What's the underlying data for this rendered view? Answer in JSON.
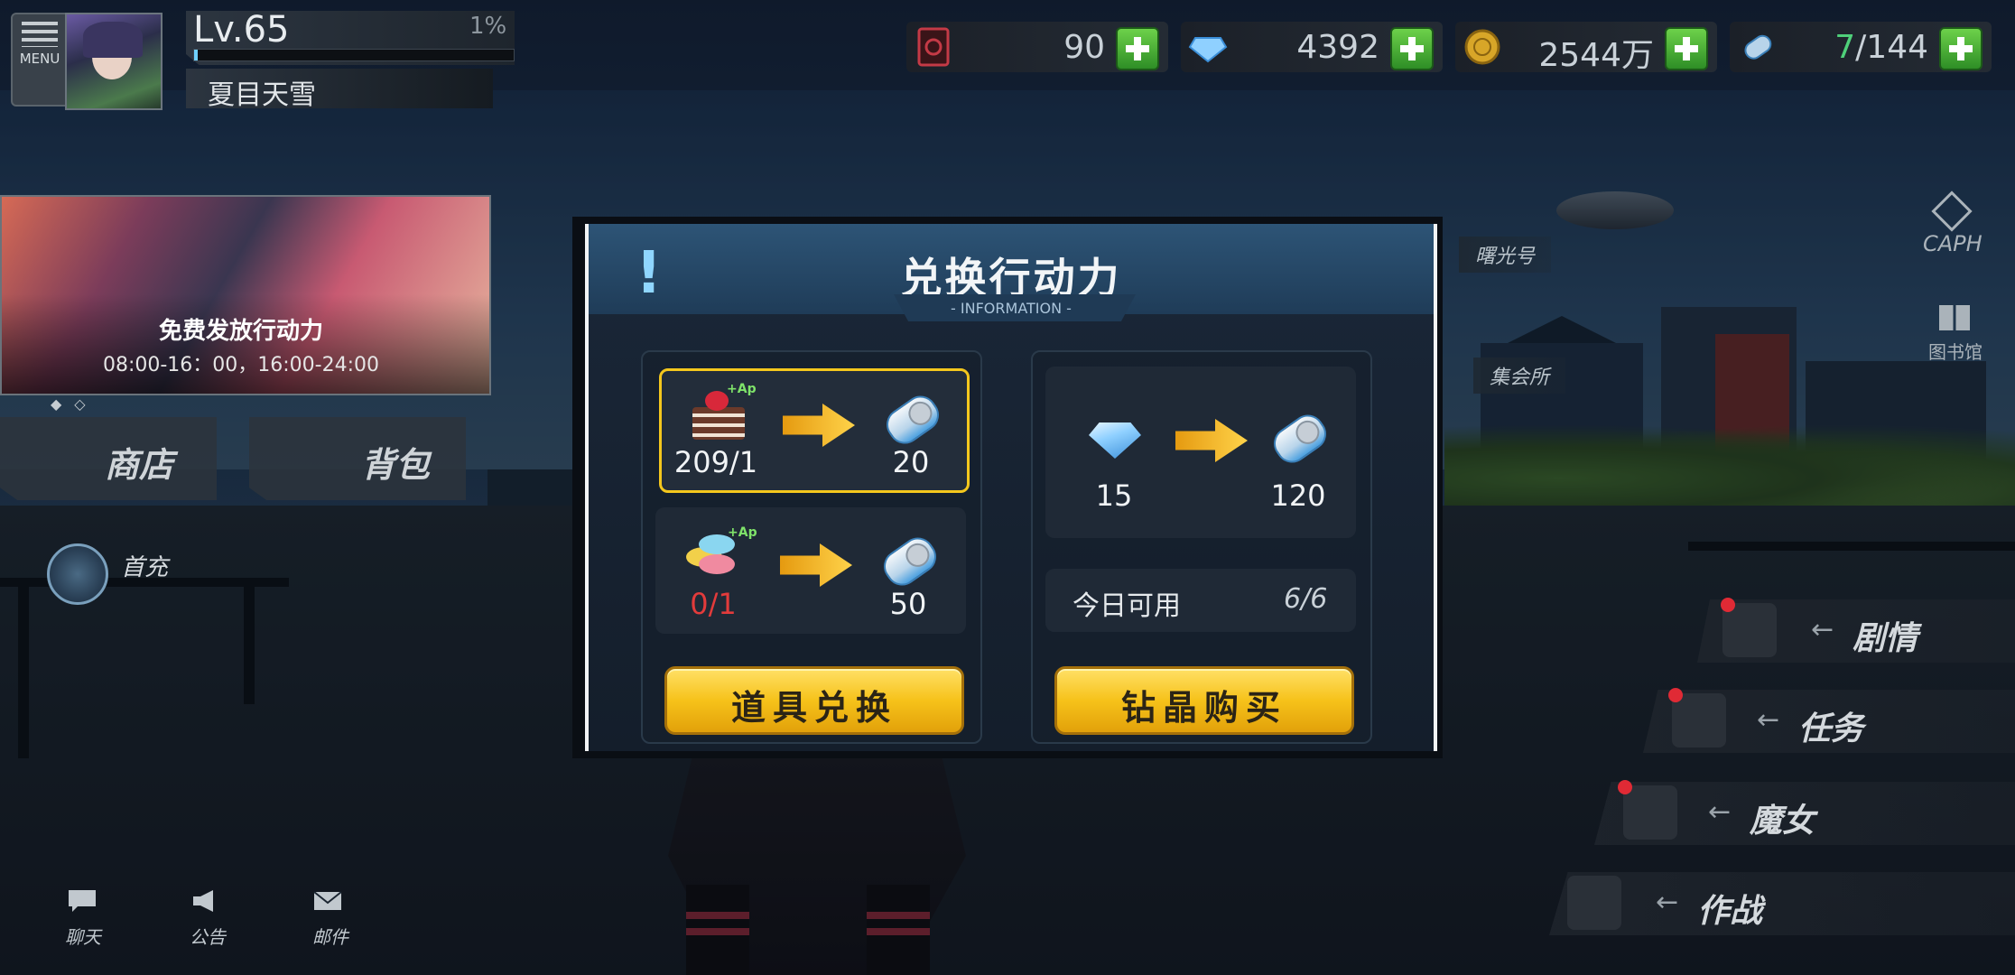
{
  "header": {
    "menu_label": "MENU",
    "level": "Lv.65",
    "exp_percent_label": "1%",
    "exp_fraction": 0.01,
    "player_name": "夏目天雪"
  },
  "resources": [
    {
      "icon": "stamina-card-icon",
      "value": "90"
    },
    {
      "icon": "diamond-icon",
      "value": "4392"
    },
    {
      "icon": "gold-coin-icon",
      "value": "2544万"
    },
    {
      "icon": "ap-ticket-icon",
      "value_current": "7",
      "value_max": "/144"
    }
  ],
  "banner": {
    "title": "免费发放行动力",
    "time": "08:00-16：00，16:00-24:00"
  },
  "left_nav": {
    "shop_label": "商店",
    "bag_label": "背包",
    "first_recharge_label": "首充"
  },
  "bottom_nav": {
    "chat_label": "聊天",
    "notice_label": "公告",
    "mail_label": "邮件"
  },
  "right_nav": {
    "caph_label": "CAPH",
    "library_label": "图书馆",
    "place_dawn": "曙光号",
    "place_gathering": "集会所",
    "story_label": "剧情",
    "quest_label": "任务",
    "witch_label": "魔女",
    "battle_label": "作战"
  },
  "modal": {
    "title": "兑换行动力",
    "subtitle": "- INFORMATION -",
    "item_exchange": [
      {
        "item": "cake-item-icon",
        "ap_tag": "+Ap",
        "count": "209/1",
        "reward": "20"
      },
      {
        "item": "macaron-item-icon",
        "ap_tag": "+Ap",
        "count": "0/1",
        "reward": "50"
      }
    ],
    "diamond_exchange": {
      "cost": "15",
      "reward": "120"
    },
    "today_label": "今日可用",
    "today_value": "6/6",
    "item_button": "道具兑换",
    "diamond_button": "钻晶购买"
  },
  "colors": {
    "accent_gold": "#f4c71d",
    "plus_green": "#4fb63a",
    "insufficient_red": "#e23b3b",
    "ap_green": "#7fe36a"
  }
}
